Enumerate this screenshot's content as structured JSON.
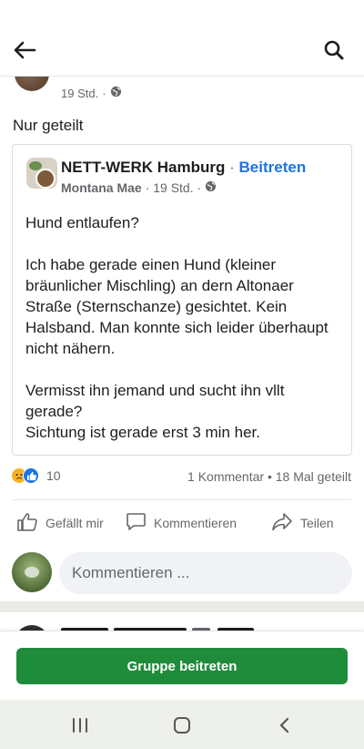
{
  "header": {
    "back_icon": "arrow-left-icon",
    "search_icon": "search-icon"
  },
  "sharer": {
    "time": "19 Std.",
    "privacy_icon": "globe-icon",
    "shared_text": "Nur geteilt"
  },
  "shared_post": {
    "group_name": "NETT-WERK Hamburg",
    "separator": "·",
    "join_label": "Beitreten",
    "author": "Montana Mae",
    "time": "· 19 Std. ·",
    "privacy_icon": "globe-icon",
    "body": [
      "Hund entlaufen?",
      "",
      "Ich habe gerade einen Hund (kleiner bräunlicher Mischling) an dern Altonaer Straße (Sternschanze) gesichtet. Kein Halsband. Man konnte sich leider überhaupt nicht nähern.",
      "",
      "Vermisst ihn jemand und sucht ihn vllt gerade?",
      "Sichtung ist gerade erst 3 min her."
    ]
  },
  "reactions": {
    "count": "10",
    "stats": "1 Kommentar • 18 Mal geteilt"
  },
  "actions": {
    "like": "Gefällt mir",
    "comment": "Kommentieren",
    "share": "Teilen"
  },
  "comment_box": {
    "placeholder": "Kommentieren ..."
  },
  "join_bar": {
    "button": "Gruppe beitreten"
  },
  "system_nav": {
    "recents_icon": "recents-icon",
    "home_icon": "home-icon",
    "back_icon": "back-chevron-icon"
  },
  "colors": {
    "accent_blue": "#1b74e4",
    "join_green": "#1f8c3b"
  }
}
